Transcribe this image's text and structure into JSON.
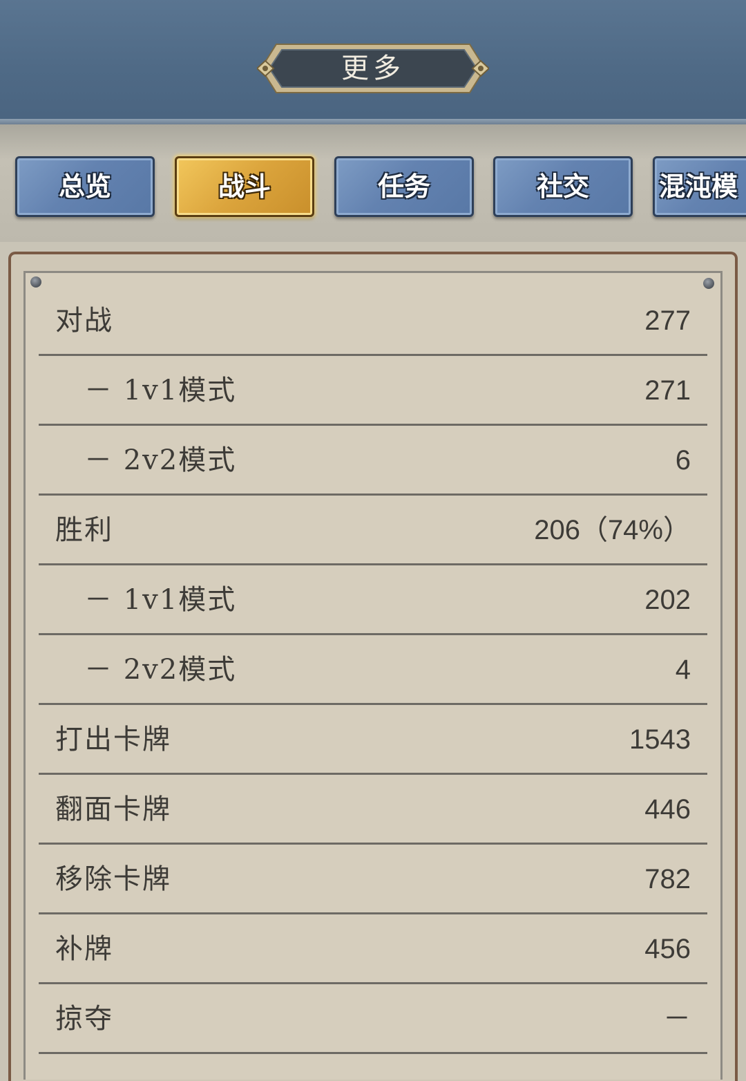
{
  "header": {
    "title": "更多"
  },
  "tabs": [
    {
      "label": "总览",
      "active": false
    },
    {
      "label": "战斗",
      "active": true
    },
    {
      "label": "任务",
      "active": false
    },
    {
      "label": "社交",
      "active": false
    },
    {
      "label": "混沌模",
      "active": false
    }
  ],
  "stats": [
    {
      "label": "对战",
      "value": "277",
      "sub": false
    },
    {
      "label": "－ 1v1模式",
      "value": "271",
      "sub": true
    },
    {
      "label": "－ 2v2模式",
      "value": "6",
      "sub": true
    },
    {
      "label": "胜利",
      "value": "206（74%）",
      "sub": false
    },
    {
      "label": "－ 1v1模式",
      "value": "202",
      "sub": true
    },
    {
      "label": "－ 2v2模式",
      "value": "4",
      "sub": true
    },
    {
      "label": "打出卡牌",
      "value": "1543",
      "sub": false
    },
    {
      "label": "翻面卡牌",
      "value": "446",
      "sub": false
    },
    {
      "label": "移除卡牌",
      "value": "782",
      "sub": false
    },
    {
      "label": "补牌",
      "value": "456",
      "sub": false
    },
    {
      "label": "掠夺",
      "value": "－",
      "sub": false
    }
  ],
  "colors": {
    "header_bg": "#546f8b",
    "tab_blue": "#6382b0",
    "tab_gold": "#dba43c",
    "panel_bg": "#d6cebd",
    "text": "#3d3b37"
  }
}
